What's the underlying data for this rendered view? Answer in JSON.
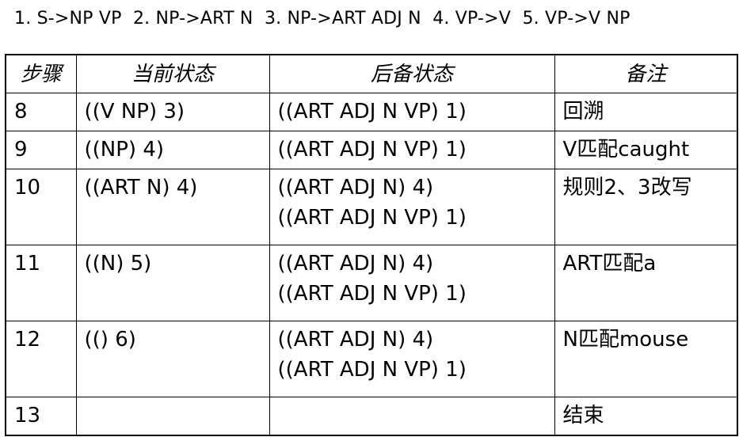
{
  "rules_line": "1. S->NP VP  2. NP->ART N  3. NP->ART ADJ N  4. VP->V  5. VP->V NP",
  "table": {
    "headers": [
      "步骤",
      "当前状态",
      "后备状态",
      "备注"
    ],
    "rows": [
      {
        "step": "8",
        "current": "((V NP) 3)",
        "backup": [
          "((ART ADJ N VP) 1)"
        ],
        "note": "回溯"
      },
      {
        "step": "9",
        "current": "((NP) 4)",
        "backup": [
          "((ART ADJ N VP) 1)"
        ],
        "note": "V匹配caught"
      },
      {
        "step": "10",
        "current": "((ART N) 4)",
        "backup": [
          "((ART ADJ N) 4)",
          "((ART ADJ N VP) 1)"
        ],
        "note": "规则2、3改写"
      },
      {
        "step": "11",
        "current": "((N) 5)",
        "backup": [
          "((ART ADJ N) 4)",
          "((ART ADJ N VP) 1)"
        ],
        "note": "ART匹配a"
      },
      {
        "step": "12",
        "current": "(() 6)",
        "backup": [
          "((ART ADJ N) 4)",
          "((ART ADJ N VP) 1)"
        ],
        "note": "N匹配mouse"
      },
      {
        "step": "13",
        "current": "",
        "backup": [
          ""
        ],
        "note": "结束"
      }
    ]
  }
}
